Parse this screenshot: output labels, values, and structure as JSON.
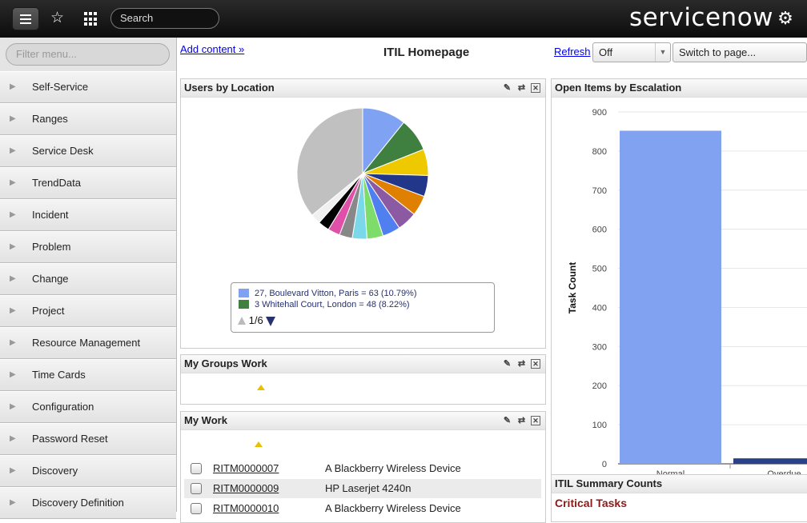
{
  "topbar": {
    "search_placeholder": "Search",
    "brand": "servicenow"
  },
  "sidebar": {
    "filter_placeholder": "Filter menu...",
    "items": [
      {
        "label": "Self-Service"
      },
      {
        "label": "Ranges"
      },
      {
        "label": "Service Desk"
      },
      {
        "label": "TrendData"
      },
      {
        "label": "Incident"
      },
      {
        "label": "Problem"
      },
      {
        "label": "Change"
      },
      {
        "label": "Project"
      },
      {
        "label": "Resource Management"
      },
      {
        "label": "Time Cards"
      },
      {
        "label": "Configuration"
      },
      {
        "label": "Password Reset"
      },
      {
        "label": "Discovery"
      },
      {
        "label": "Discovery Definition"
      }
    ]
  },
  "header": {
    "add_content": "Add content »",
    "title": "ITIL Homepage",
    "refresh": "Refresh",
    "refresh_value": "Off",
    "switch_page": "Switch to page..."
  },
  "users_by_location": {
    "title": "Users by Location",
    "legend": [
      {
        "label": "27, Boulevard Vitton, Paris = 63 (10.79%)",
        "color": "#7fa3f2"
      },
      {
        "label": "3 Whitehall Court, London = 48 (8.22%)",
        "color": "#3f7f3f"
      }
    ],
    "pager": "1/6"
  },
  "my_groups_work": {
    "title": "My Groups Work"
  },
  "my_work": {
    "title": "My Work",
    "rows": [
      {
        "number": "RITM0000007",
        "description": "A Blackberry Wireless Device"
      },
      {
        "number": "RITM0000009",
        "description": "HP Laserjet 4240n"
      },
      {
        "number": "RITM0000010",
        "description": "A Blackberry Wireless Device"
      }
    ]
  },
  "open_items": {
    "title": "Open Items by Escalation"
  },
  "itil_summary": {
    "title": "ITIL Summary Counts",
    "critical": "Critical Tasks"
  },
  "chart_data": [
    {
      "type": "pie",
      "values": [
        10.79,
        8.22,
        6.5,
        5.2,
        5.0,
        4.9,
        4.4,
        4.0,
        3.6,
        3.2,
        3.0,
        2.8,
        2.5,
        36.0
      ],
      "colors": [
        "#7fa3f2",
        "#3f7f3f",
        "#eec900",
        "#22378a",
        "#e08000",
        "#8c5aa3",
        "#5080f0",
        "#7ddc6a",
        "#7ad8e8",
        "#888888",
        "#e050a8",
        "#000000",
        "#f0f0f0",
        "#c0c0c0"
      ]
    },
    {
      "type": "bar",
      "categories": [
        "Normal",
        "Overdue"
      ],
      "values": [
        852,
        14
      ],
      "colors": [
        "#80a2f0",
        "#27418a"
      ],
      "ylabel": "Task Count",
      "ylim": [
        0,
        900
      ],
      "yticks": [
        0,
        100,
        200,
        300,
        400,
        500,
        600,
        700,
        800,
        900
      ]
    }
  ]
}
